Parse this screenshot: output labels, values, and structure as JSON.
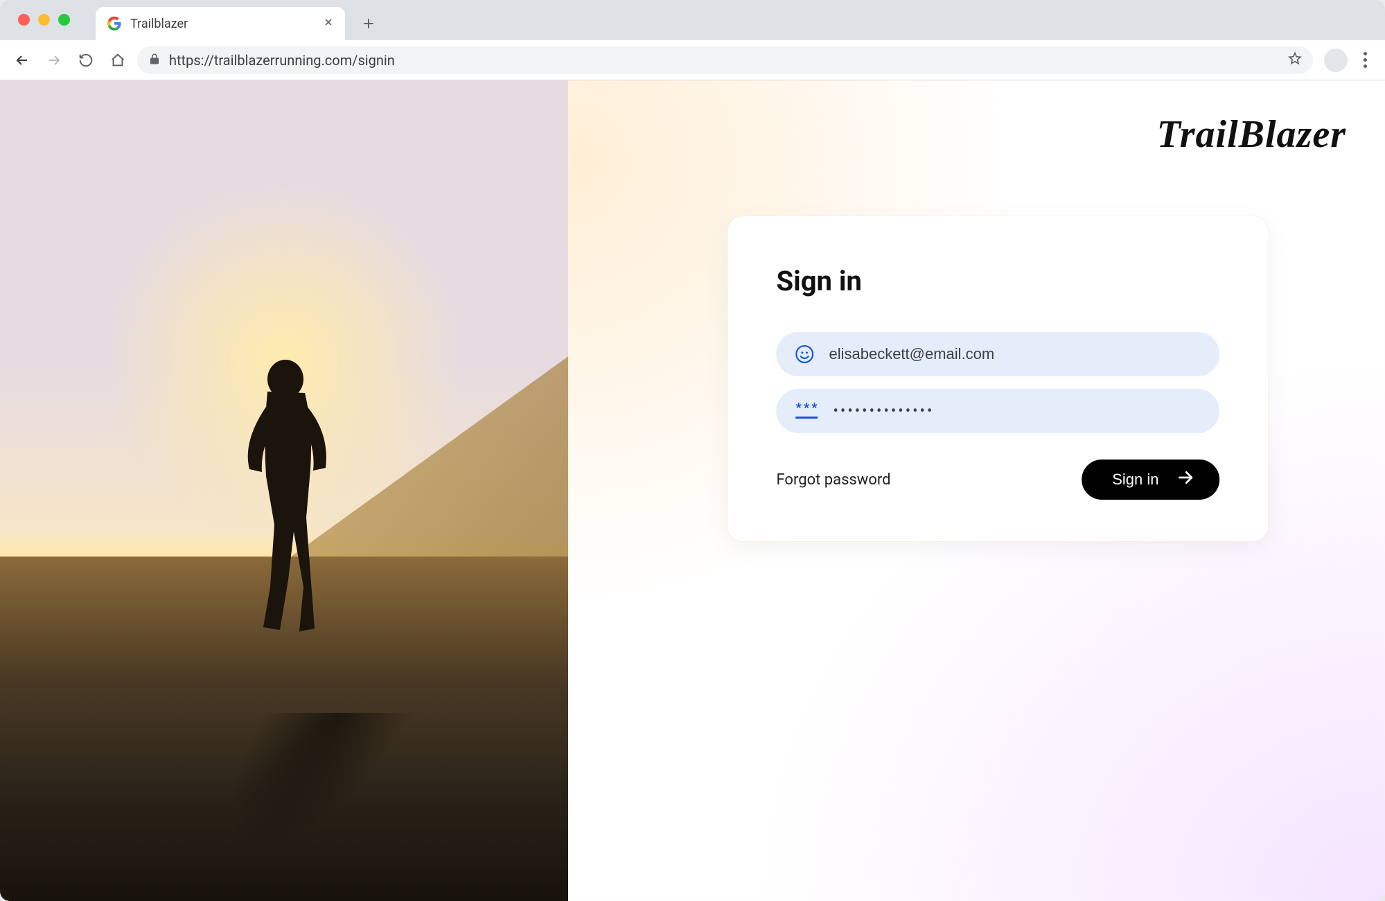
{
  "browser": {
    "tab_title": "Trailblazer",
    "url": "https://trailblazerrunning.com/signin"
  },
  "brand": "TrailBlazer",
  "signin": {
    "heading": "Sign in",
    "email_value": "elisabeckett@email.com",
    "password_mask": "••••••••••••••",
    "forgot_label": "Forgot password",
    "submit_label": "Sign in"
  }
}
